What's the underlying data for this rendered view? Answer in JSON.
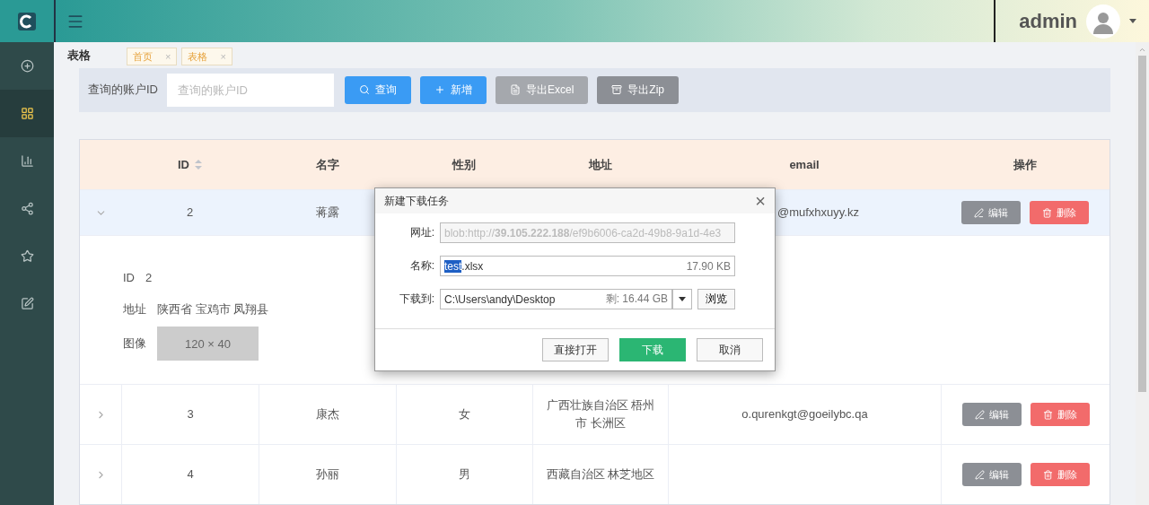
{
  "header": {
    "username": "admin"
  },
  "sidebar": {
    "items": [
      {
        "selected": false
      },
      {
        "selected": true
      },
      {
        "selected": false
      },
      {
        "selected": false
      },
      {
        "selected": false
      },
      {
        "selected": false
      }
    ]
  },
  "page_title": "表格",
  "tabs": [
    {
      "label": "首页",
      "close": "×"
    },
    {
      "label": "表格",
      "close": "×"
    }
  ],
  "search": {
    "label": "查询的账户ID",
    "placeholder": "查询的账户ID",
    "buttons": [
      {
        "kind": "primary",
        "label": "查询"
      },
      {
        "kind": "primary",
        "label": "新增"
      },
      {
        "kind": "muted",
        "label": "导出Excel"
      },
      {
        "kind": "dark",
        "label": "导出Zip"
      }
    ]
  },
  "table": {
    "columns": [
      "ID",
      "名字",
      "性别",
      "地址",
      "email",
      "操作"
    ],
    "rows": [
      {
        "expanded": true,
        "id": "2",
        "name": "蒋露",
        "email": "@mufxhxuyy.kz",
        "actions": [
          "编辑",
          "删除"
        ],
        "details": {
          "id_label": "ID",
          "id_value": "2",
          "address_label": "地址",
          "address_value": "陕西省 宝鸡市 凤翔县",
          "image_label": "图像",
          "image_placeholder": "120 × 40"
        }
      },
      {
        "expanded": false,
        "id": "3",
        "name": "康杰",
        "gender": "女",
        "address": "广西壮族自治区 梧州市 长洲区",
        "email": "o.qurenkgt@goeilybc.qa",
        "actions": [
          "编辑",
          "删除"
        ]
      },
      {
        "expanded": false,
        "id": "4",
        "name": "孙丽",
        "gender": "男",
        "address": "西藏自治区 林芝地区",
        "actions": [
          "编辑",
          "删除"
        ]
      }
    ]
  },
  "dialog": {
    "title": "新建下载任务",
    "close": "×",
    "url_label": "网址:",
    "url": "blob:http://**39.105.222.188**/ef9b6006-ca2d-49b8-9a1d-4e3",
    "name_label": "名称:",
    "name_selected": "test",
    "name_rest": ".xlsx",
    "size": "17.90 KB",
    "dest_label": "下载到:",
    "dest_path": "C:\\Users\\andy\\Desktop",
    "free_space": "剩: 16.44 GB",
    "browse": "浏览",
    "buttons": [
      {
        "kind": "default",
        "label": "直接打开"
      },
      {
        "kind": "primary",
        "label": "下载"
      },
      {
        "kind": "default",
        "label": "取消"
      }
    ]
  }
}
